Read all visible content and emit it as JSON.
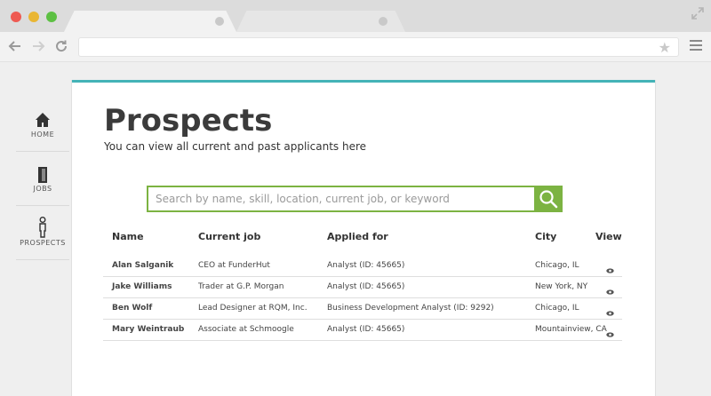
{
  "browser": {
    "address": ""
  },
  "nav": {
    "items": [
      {
        "label": "HOME",
        "icon": "home-icon"
      },
      {
        "label": "JOBS",
        "icon": "jobs-icon"
      },
      {
        "label": "PROSPECTS",
        "icon": "person-icon"
      }
    ]
  },
  "page": {
    "title": "Prospects",
    "subtitle": "You can view all current and past applicants here"
  },
  "search": {
    "placeholder": "Search by name, skill, location, current job, or keyword"
  },
  "table": {
    "headers": {
      "name": "Name",
      "job": "Current job",
      "applied": "Applied for",
      "city": "City",
      "view": "View"
    },
    "rows": [
      {
        "name": "Alan Salganik",
        "job": "CEO at FunderHut",
        "applied": "Analyst (ID: 45665)",
        "city": "Chicago, IL"
      },
      {
        "name": "Jake Williams",
        "job": "Trader at G.P. Morgan",
        "applied": "Analyst (ID: 45665)",
        "city": "New York, NY"
      },
      {
        "name": "Ben Wolf",
        "job": "Lead Designer at RQM, Inc.",
        "applied": "Business Development Analyst (ID: 9292)",
        "city": "Chicago, IL"
      },
      {
        "name": "Mary Weintraub",
        "job": "Associate at Schmoogle",
        "applied": "Analyst (ID: 45665)",
        "city": "Mountainview, CA"
      }
    ]
  },
  "colors": {
    "accent": "#44b3b7",
    "search": "#7cb342"
  }
}
